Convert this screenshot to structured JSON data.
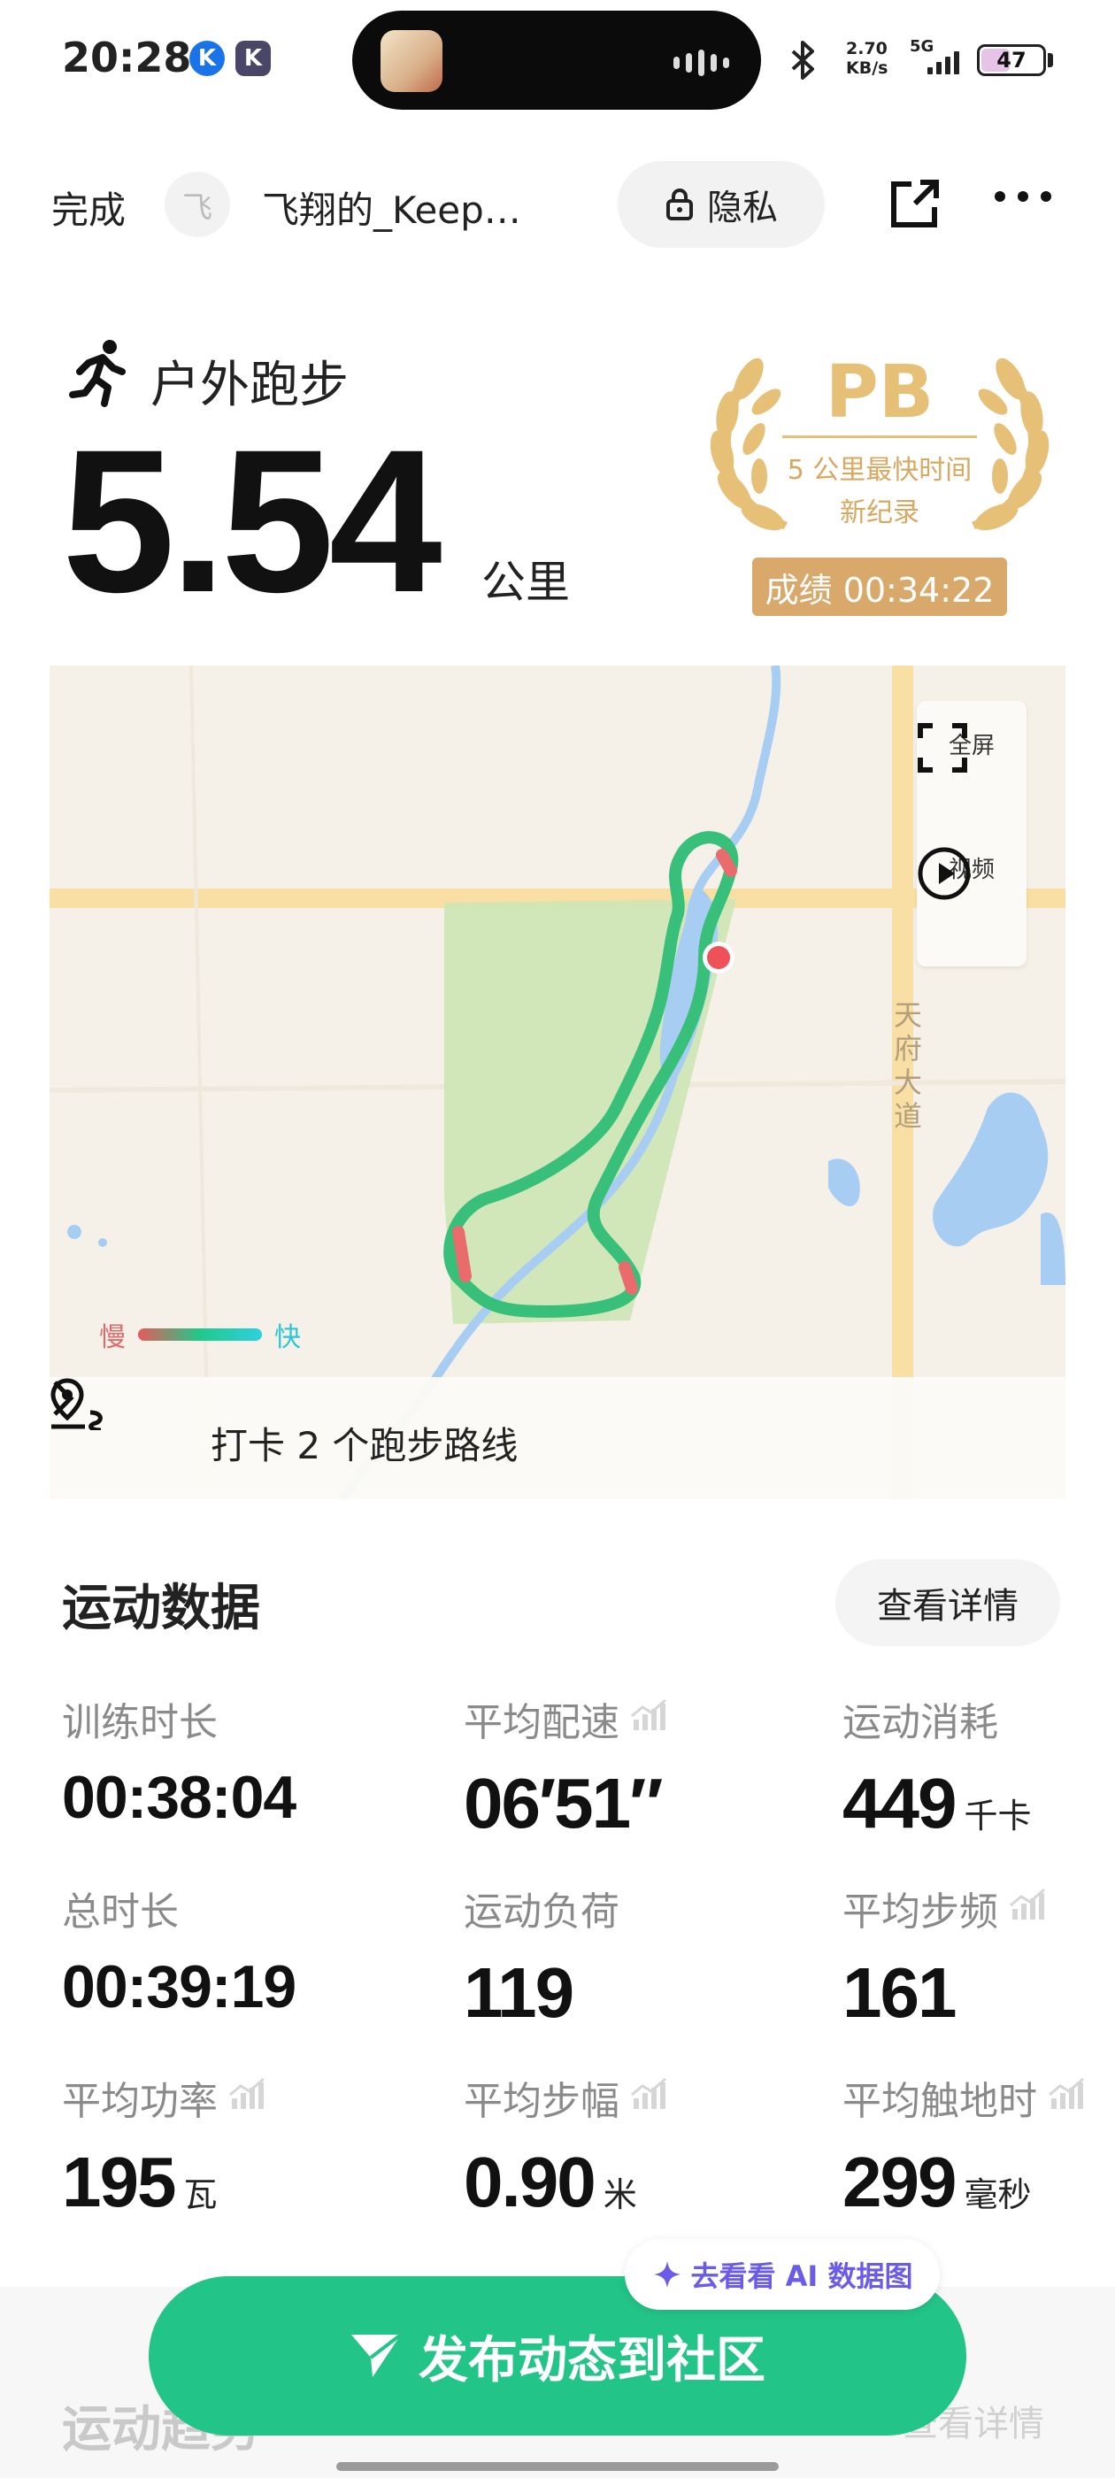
{
  "status_bar": {
    "time": "20:28",
    "app_badges": [
      "K",
      "K"
    ],
    "net_speed_value": "2.70",
    "net_speed_unit": "KB/s",
    "network": "5G",
    "battery": "47",
    "battery_level": 0.47
  },
  "header": {
    "done_label": "完成",
    "avatar_text": "飞",
    "username": "飞翔的_Keep…",
    "privacy_label": "隐私",
    "icons": [
      "lock-icon",
      "share-icon",
      "more-icon"
    ]
  },
  "summary": {
    "sport_type": "户外跑步",
    "distance": "5.54",
    "distance_unit": "公里"
  },
  "pb": {
    "title": "PB",
    "line1": "5 公里最快时间",
    "line2": "新纪录",
    "score": "成绩 00:34:22"
  },
  "map": {
    "fullscreen_label": "全屏",
    "video_label": "视频",
    "road_name": "天府大道",
    "legend_slow": "慢",
    "legend_fast": "快",
    "checkin_label": "打卡 2 个跑步路线"
  },
  "stats": {
    "title": "运动数据",
    "detail_label": "查看详情",
    "items": [
      {
        "label": "训练时长",
        "value": "00:38:04",
        "unit": "",
        "trend": false
      },
      {
        "label": "平均配速",
        "value": "06′51″",
        "unit": "",
        "trend": true
      },
      {
        "label": "运动消耗",
        "value": "449",
        "unit": "千卡",
        "trend": false
      },
      {
        "label": "总时长",
        "value": "00:39:19",
        "unit": "",
        "trend": false
      },
      {
        "label": "运动负荷",
        "value": "119",
        "unit": "",
        "trend": false
      },
      {
        "label": "平均步频",
        "value": "161",
        "unit": "",
        "trend": true
      },
      {
        "label": "平均功率",
        "value": "195",
        "unit": "瓦",
        "trend": true
      },
      {
        "label": "平均步幅",
        "value": "0.90",
        "unit": "米",
        "trend": true
      },
      {
        "label": "平均触地时",
        "value": "299",
        "unit": "毫秒",
        "trend": true
      }
    ]
  },
  "bottom": {
    "ai_label": "去看看 AI 数据图",
    "publish_label": "发布动态到社区",
    "next_title": "运动趋势",
    "next_detail": "查看详情"
  },
  "colors": {
    "brand_green": "#23c488",
    "pb_gold": "#d9a96b",
    "ai_purple": "#6a5ce6"
  }
}
